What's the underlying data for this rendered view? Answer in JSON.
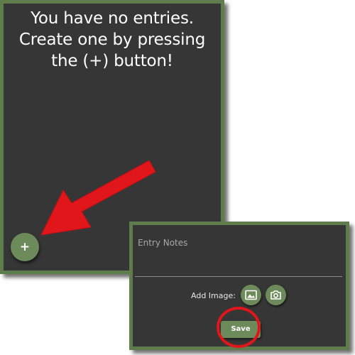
{
  "entries_screen": {
    "empty_message_lines": [
      "You have no entries.",
      "Create one by pressing",
      "the (+) button!"
    ],
    "add_button_label": "+"
  },
  "editor": {
    "notes_placeholder": "Entry Notes",
    "add_image_label": "Add Image:",
    "gallery_icon": "image-gallery-icon",
    "camera_icon": "camera-icon",
    "save_label": "Save"
  },
  "annotations": {
    "arrow_color": "#e0161b",
    "highlight_color": "#e0161b"
  },
  "theme": {
    "panel_background": "#363636",
    "border_green": "#5f7d4c",
    "button_green": "#6d8b5a"
  }
}
